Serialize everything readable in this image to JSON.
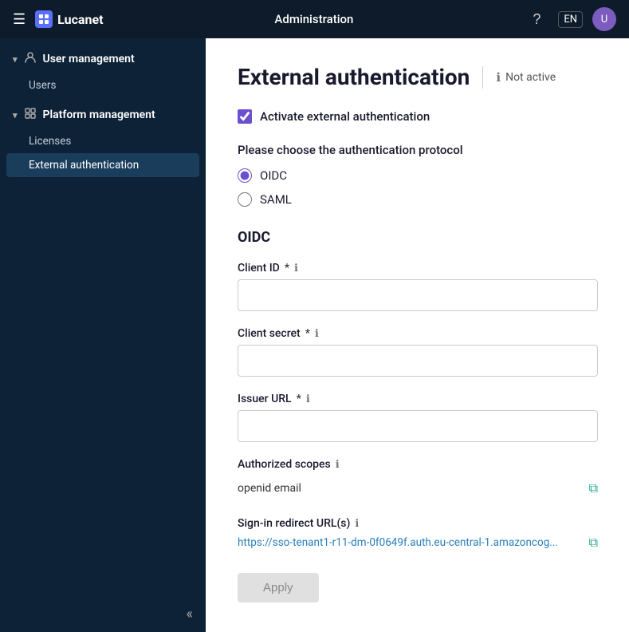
{
  "topbar": {
    "title": "Administration",
    "lang": "EN",
    "logo_text": "Lucanet"
  },
  "sidebar": {
    "user_management": {
      "label": "User management",
      "items": [
        {
          "id": "users",
          "label": "Users",
          "active": false
        }
      ]
    },
    "platform_management": {
      "label": "Platform management",
      "items": [
        {
          "id": "licenses",
          "label": "Licenses",
          "active": false
        },
        {
          "id": "external-authentication",
          "label": "External authentication",
          "active": true
        }
      ]
    },
    "collapse_label": "«"
  },
  "page": {
    "title": "External authentication",
    "status": "Not active",
    "activate_label": "Activate external authentication",
    "protocol_label": "Please choose the authentication protocol",
    "protocols": [
      {
        "id": "oidc",
        "label": "OIDC",
        "selected": true
      },
      {
        "id": "saml",
        "label": "SAML",
        "selected": false
      }
    ],
    "oidc": {
      "section_title": "OIDC",
      "client_id": {
        "label": "Client ID",
        "required": true,
        "value": "",
        "placeholder": ""
      },
      "client_secret": {
        "label": "Client secret",
        "required": true,
        "value": "",
        "placeholder": ""
      },
      "issuer_url": {
        "label": "Issuer URL",
        "required": true,
        "value": "",
        "placeholder": ""
      },
      "authorized_scopes": {
        "label": "Authorized scopes",
        "value": "openid email"
      },
      "redirect_url": {
        "label": "Sign-in redirect URL(s)",
        "value": "https://sso-tenant1-r11-dm-0f0649f.auth.eu-central-1.amazoncog..."
      }
    },
    "apply_label": "Apply"
  },
  "icons": {
    "hamburger": "☰",
    "help": "?",
    "collapse": "«",
    "info": "ℹ",
    "copy": "⧉",
    "chevron_down": "▾",
    "user_group": "👤",
    "platform": "📋"
  }
}
